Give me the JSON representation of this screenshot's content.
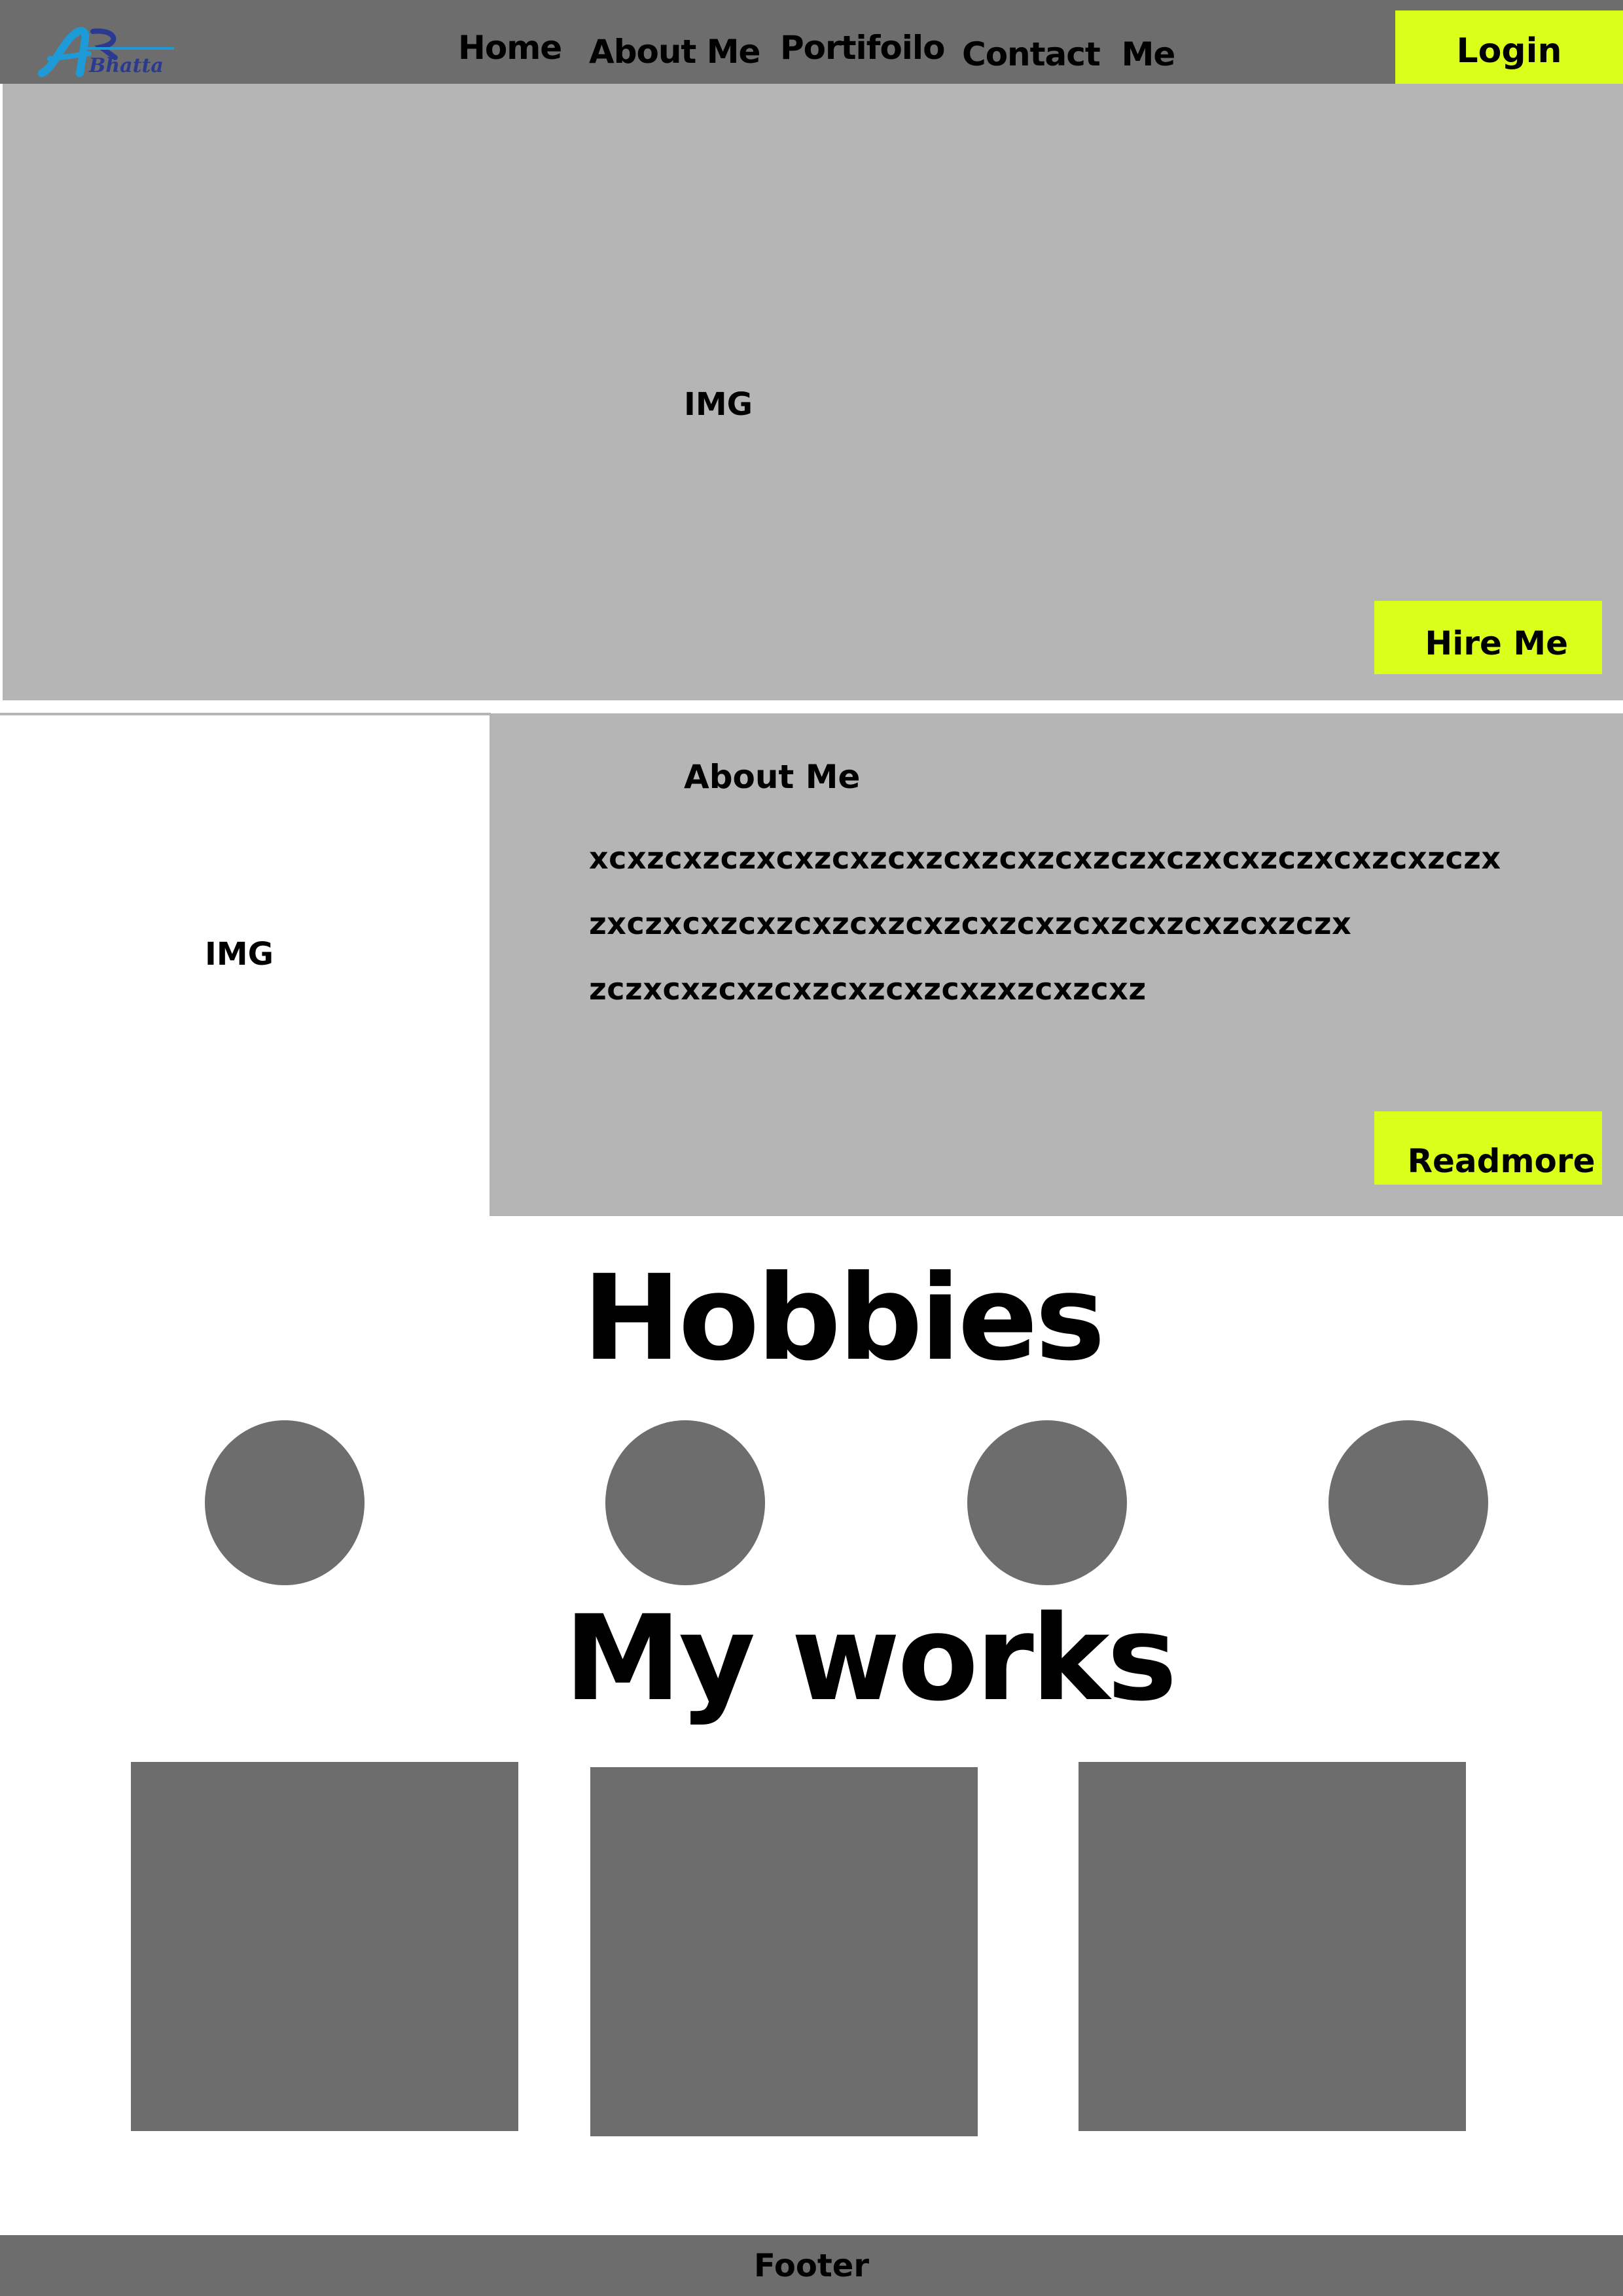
{
  "nav": {
    "logo_text_primary": "AR",
    "logo_text_secondary": "Bhatta",
    "links": [
      "Home",
      "About Me",
      "Portifoilo",
      "Contact  Me"
    ],
    "login_label": "Login"
  },
  "hero": {
    "img_label": "IMG",
    "hire_label": "Hire Me"
  },
  "about": {
    "img_label": "IMG",
    "title": "About Me",
    "lines": [
      "xcxzcxzczxcxzcxzcxzcxzcxzcxzczxczxcxzczxcxzcxzczx",
      "zxczxcxzcxzcxzcxzcxzcxzcxzcxzcxzcxzcxzczx",
      "zczxcxzcxzcxzcxzcxzcxzxzcxzcxz"
    ],
    "readmore_label": "Readmore"
  },
  "hobbies": {
    "title": "Hobbies",
    "count": 4
  },
  "works": {
    "title": "My works",
    "count": 3
  },
  "footer": {
    "label": "Footer"
  },
  "colors": {
    "nav_bg": "#6d6d6d",
    "panel_bg": "#b5b5b5",
    "accent": "#d9ff1a",
    "placeholder": "#6d6d6d",
    "logo_blue": "#1e9ad6",
    "logo_navy": "#2b3a8f"
  }
}
